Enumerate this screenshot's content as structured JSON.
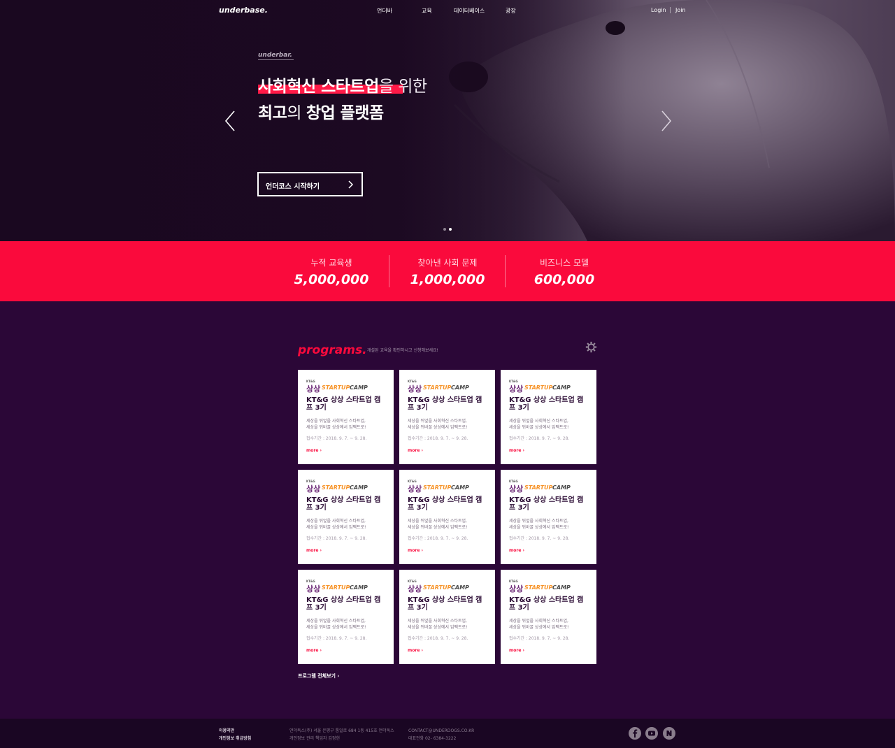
{
  "header": {
    "logo": "underbase.",
    "nav": [
      "언더바",
      "교육",
      "데이터베이스",
      "광장"
    ],
    "login": "Login",
    "join": "Join"
  },
  "hero": {
    "eyebrow": "underbar.",
    "line1_bold": "사회혁신 스타트업",
    "line1_thin": "을 위한",
    "line2_bold_a": "최고",
    "line2_thin": "의 ",
    "line2_bold_b": "창업 플랫폼",
    "cta": "언더코스 시작하기",
    "accent": "#ff1a47",
    "slides": 2,
    "active_slide": 2
  },
  "stats": [
    {
      "label": "누적 교육생",
      "value": "5,000,000"
    },
    {
      "label": "찾아낸 사회 문제",
      "value": "1,000,000"
    },
    {
      "label": "비즈니스 모델",
      "value": "600,000"
    }
  ],
  "programs": {
    "title": "programs.",
    "subtitle": "개설된 교육을 확인하시고 신청해보세요!",
    "view_all": "프로그램 전체보기",
    "cards": [
      {
        "logo_kt": "KT&G",
        "logo_ss": "상상",
        "logo_startup": "STARTUP",
        "logo_camp": "CAMP",
        "title": "KT&G 상상 스타트업 캠프 3기",
        "desc1": "세상을 뒤엎을 사회혁신 스타트업,",
        "desc2": "세상을 뒤바꿀 상상에서 임팩트로!",
        "date": "접수기간 : 2018. 9. 7. ~ 9. 28.",
        "more": "more"
      },
      {
        "logo_kt": "KT&G",
        "logo_ss": "상상",
        "logo_startup": "STARTUP",
        "logo_camp": "CAMP",
        "title": "KT&G 상상 스타트업 캠프 3기",
        "desc1": "세상을 뒤엎을 사회혁신 스타트업,",
        "desc2": "세상을 뒤바꿀 상상에서 임팩트로!",
        "date": "접수기간 : 2018. 9. 7. ~ 9. 28.",
        "more": "more"
      },
      {
        "logo_kt": "KT&G",
        "logo_ss": "상상",
        "logo_startup": "STARTUP",
        "logo_camp": "CAMP",
        "title": "KT&G 상상 스타트업 캠프 3기",
        "desc1": "세상을 뒤엎을 사회혁신 스타트업,",
        "desc2": "세상을 뒤바꿀 상상에서 임팩트로!",
        "date": "접수기간 : 2018. 9. 7. ~ 9. 28.",
        "more": "more"
      },
      {
        "logo_kt": "KT&G",
        "logo_ss": "상상",
        "logo_startup": "STARTUP",
        "logo_camp": "CAMP",
        "title": "KT&G 상상 스타트업 캠프 3기",
        "desc1": "세상을 뒤엎을 사회혁신 스타트업,",
        "desc2": "세상을 뒤바꿀 상상에서 임팩트로!",
        "date": "접수기간 : 2018. 9. 7. ~ 9. 28.",
        "more": "more"
      },
      {
        "logo_kt": "KT&G",
        "logo_ss": "상상",
        "logo_startup": "STARTUP",
        "logo_camp": "CAMP",
        "title": "KT&G 상상 스타트업 캠프 3기",
        "desc1": "세상을 뒤엎을 사회혁신 스타트업,",
        "desc2": "세상을 뒤바꿀 상상에서 임팩트로!",
        "date": "접수기간 : 2018. 9. 7. ~ 9. 28.",
        "more": "more"
      },
      {
        "logo_kt": "KT&G",
        "logo_ss": "상상",
        "logo_startup": "STARTUP",
        "logo_camp": "CAMP",
        "title": "KT&G 상상 스타트업 캠프 3기",
        "desc1": "세상을 뒤엎을 사회혁신 스타트업,",
        "desc2": "세상을 뒤바꿀 상상에서 임팩트로!",
        "date": "접수기간 : 2018. 9. 7. ~ 9. 28.",
        "more": "more"
      },
      {
        "logo_kt": "KT&G",
        "logo_ss": "상상",
        "logo_startup": "STARTUP",
        "logo_camp": "CAMP",
        "title": "KT&G 상상 스타트업 캠프 3기",
        "desc1": "세상을 뒤엎을 사회혁신 스타트업,",
        "desc2": "세상을 뒤바꿀 상상에서 임팩트로!",
        "date": "접수기간 : 2018. 9. 7. ~ 9. 28.",
        "more": "more"
      },
      {
        "logo_kt": "KT&G",
        "logo_ss": "상상",
        "logo_startup": "STARTUP",
        "logo_camp": "CAMP",
        "title": "KT&G 상상 스타트업 캠프 3기",
        "desc1": "세상을 뒤엎을 사회혁신 스타트업,",
        "desc2": "세상을 뒤바꿀 상상에서 임팩트로!",
        "date": "접수기간 : 2018. 9. 7. ~ 9. 28.",
        "more": "more"
      },
      {
        "logo_kt": "KT&G",
        "logo_ss": "상상",
        "logo_startup": "STARTUP",
        "logo_camp": "CAMP",
        "title": "KT&G 상상 스타트업 캠프 3기",
        "desc1": "세상을 뒤엎을 사회혁신 스타트업,",
        "desc2": "세상을 뒤바꿀 상상에서 임팩트로!",
        "date": "접수기간 : 2018. 9. 7. ~ 9. 28.",
        "more": "more"
      }
    ]
  },
  "footer": {
    "terms": "이용약관",
    "privacy": "개인정보 취급방침",
    "company": "언더독스(주) 서울 은평구 통일로 684 1동 415호 언더독스",
    "privacy_officer": "개인정보 관리 책임자 김정헌",
    "contact": "CONTACT@UNDERDOGS.CO.KR",
    "phone": "대표전화 02- 6384-3222",
    "social": [
      "facebook-icon",
      "youtube-icon",
      "naver-icon"
    ]
  },
  "colors": {
    "brand_red": "#fa0a3c",
    "page_bg": "#2b0737",
    "footer_bg": "#1a0623"
  }
}
